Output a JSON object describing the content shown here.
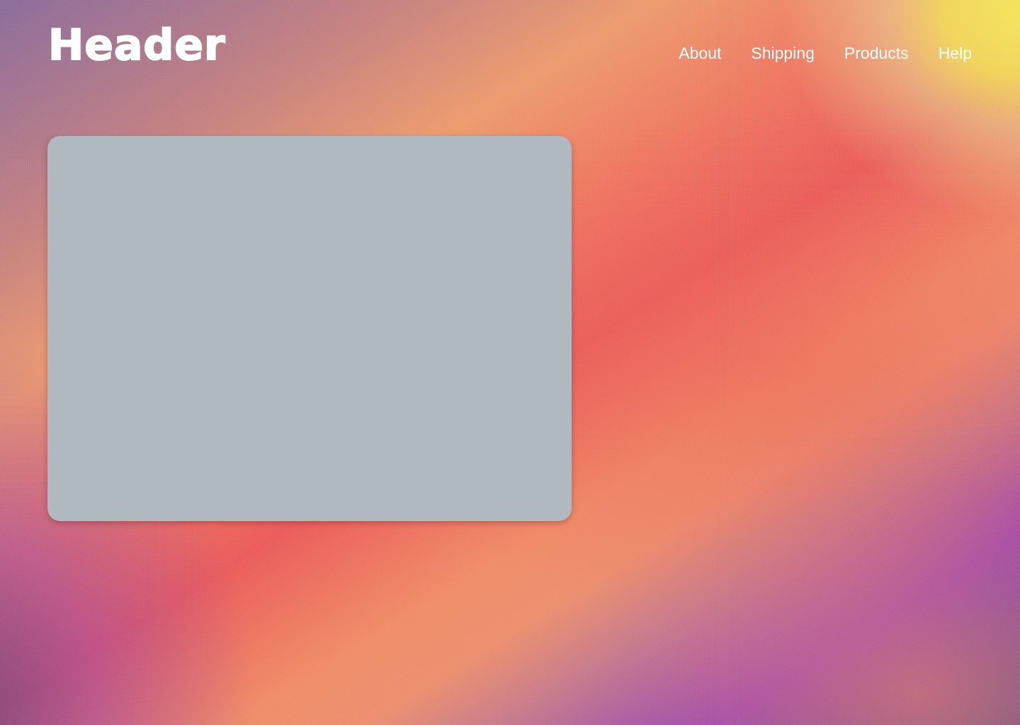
{
  "header": {
    "logo_text": "Header",
    "nav": [
      {
        "label": "About"
      },
      {
        "label": "Shipping"
      },
      {
        "label": "Products"
      },
      {
        "label": "Help"
      }
    ]
  },
  "colors": {
    "card": "#b0b8c0",
    "nav_text": "#ffffff",
    "gradient_purple": "#9845b3",
    "gradient_coral": "#ea5a58",
    "gradient_peach": "#ec9a6c",
    "gradient_yellow": "#f2e55a"
  }
}
